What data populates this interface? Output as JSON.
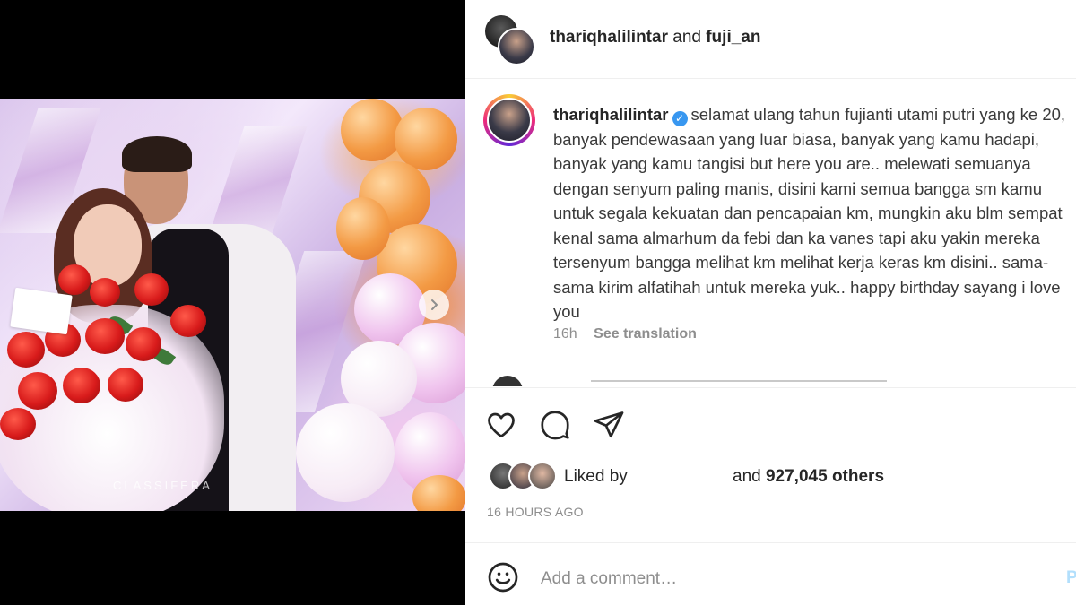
{
  "header": {
    "user1": "thariqhalilintar",
    "and": "and",
    "user2": "fuji_an"
  },
  "caption": {
    "username": "thariqhalilintar",
    "verified_badge": "✓",
    "text": "selamat ulang tahun fujianti utami putri yang ke 20, banyak pendewasaan yang luar biasa, banyak yang kamu hadapi, banyak yang kamu tangisi but here you are.. melewati semuanya dengan senyum paling manis, disini kami semua bangga sm kamu untuk segala kekuatan dan pencapaian km, mungkin aku blm sempat kenal sama almarhum da febi dan ka vanes tapi aku yakin mereka tersenyum bangga melihat km melihat kerja keras km disini.. sama-sama kirim alfatihah untuk mereka yuk.. happy birthday sayang i love you",
    "age": "16h",
    "see_translation": "See translation"
  },
  "photo": {
    "watermark": "CLASSIFERA"
  },
  "likes": {
    "liked_by": "Liked by",
    "and": "and",
    "count": "927,045 others"
  },
  "timestamp": "16 HOURS AGO",
  "comment": {
    "placeholder": "Add a comment…",
    "post_label": "P"
  },
  "icons": {
    "like": "heart-icon",
    "comment": "comment-icon",
    "share": "share-icon",
    "next": "chevron-right-icon",
    "emoji": "emoji-icon"
  },
  "colors": {
    "verified": "#3897f0",
    "secondary_text": "#8e8e8e",
    "post_button": "#b2dffc"
  }
}
